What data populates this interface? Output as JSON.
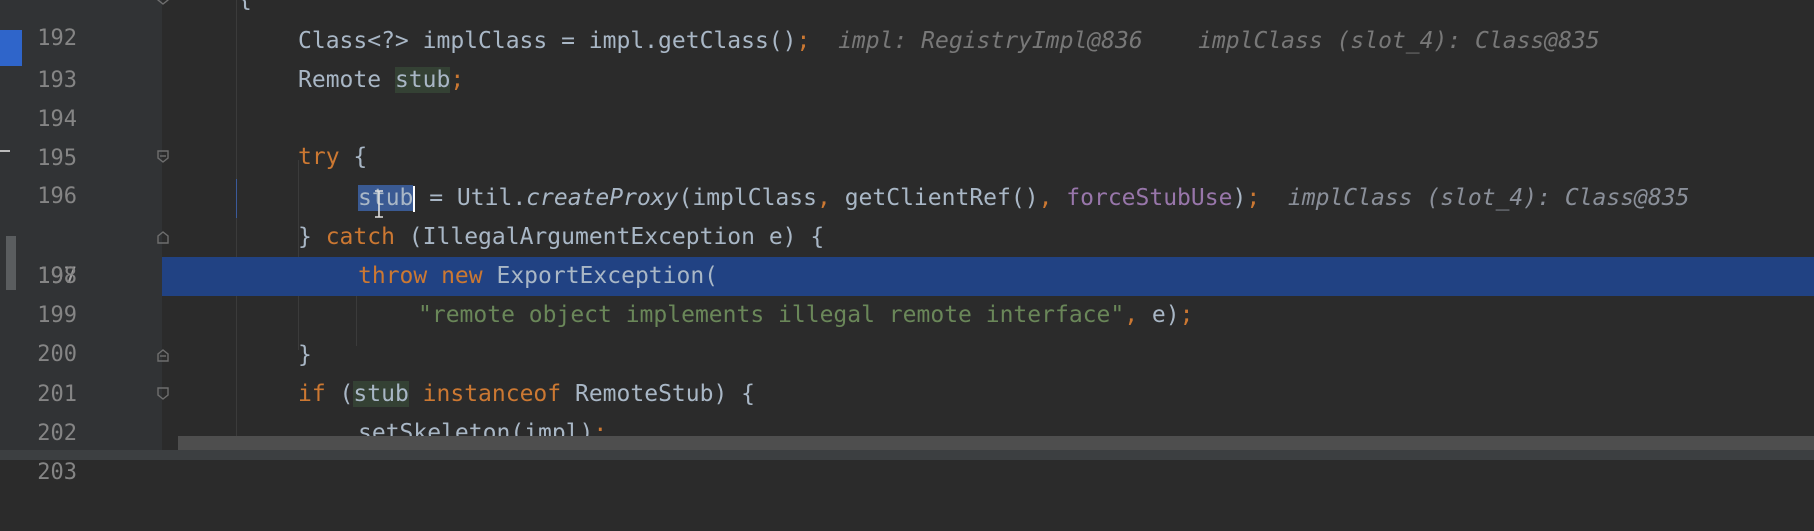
{
  "editor": {
    "lines": [
      {
        "num": "192",
        "text": "{"
      },
      {
        "num": "193",
        "parts": [
          "Class<?> implClass = impl.getClass()",
          ";"
        ],
        "hints": [
          "impl: RegistryImpl@836",
          "implClass (slot_4): Class@835"
        ]
      },
      {
        "num": "194",
        "parts": [
          "Remote ",
          "stub",
          ";"
        ]
      },
      {
        "num": "195"
      },
      {
        "num": "196",
        "parts": [
          "try",
          " {"
        ]
      },
      {
        "num": "197",
        "parts": [
          "stub",
          " = Util.",
          "createProxy",
          "(implClass",
          ",",
          " getClientRef()",
          ",",
          " ",
          "forceStubUse",
          ")",
          ";"
        ],
        "hints": [
          "implClass (slot_4): Class@835"
        ]
      },
      {
        "num": "198",
        "parts": [
          "} ",
          "catch",
          " (IllegalArgumentException e) {"
        ]
      },
      {
        "num": "199",
        "parts": [
          "throw new",
          " ExportException("
        ]
      },
      {
        "num": "200",
        "parts": [
          "\"remote object implements illegal remote interface\"",
          ",",
          " e)",
          ";"
        ]
      },
      {
        "num": "201",
        "parts": [
          "}"
        ]
      },
      {
        "num": "202",
        "parts": [
          "if",
          " (",
          "stub",
          " ",
          "instanceof",
          " RemoteStub) {"
        ]
      },
      {
        "num": "203",
        "parts": [
          "setSkeleton(impl)",
          ";"
        ]
      }
    ]
  },
  "colors": {
    "background": "#2b2b2b",
    "gutter": "#313335",
    "highlight": "#214283",
    "keyword": "#cc7832",
    "string": "#6a8759",
    "field": "#9876aa",
    "text": "#a9b7c6",
    "hint": "#787878"
  }
}
